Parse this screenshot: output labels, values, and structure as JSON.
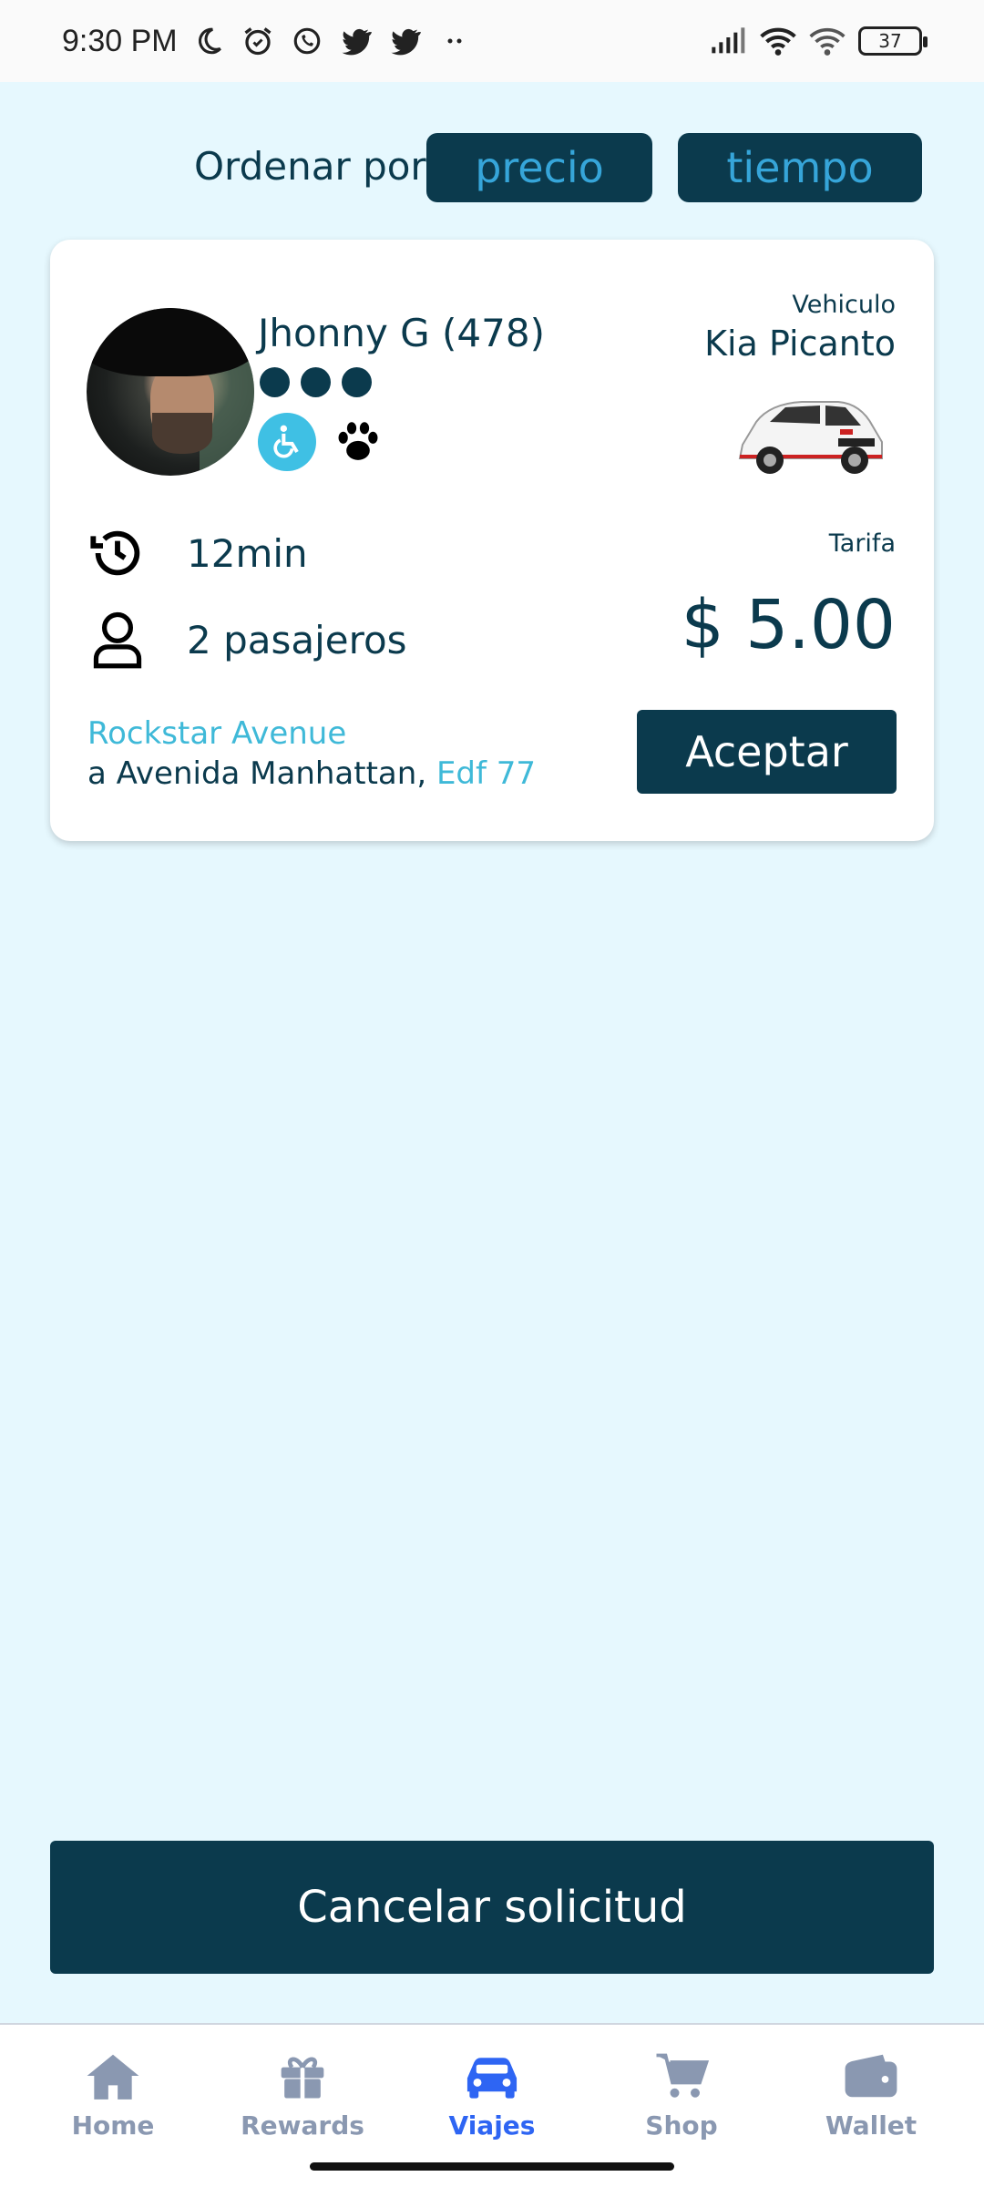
{
  "status_bar": {
    "time": "9:30 PM",
    "battery": "37"
  },
  "sort": {
    "label": "Ordenar por",
    "option_price": "precio",
    "option_time": "tiempo"
  },
  "trip_card": {
    "driver_name": "Jhonny G (478)",
    "vehicle_label": "Vehiculo",
    "vehicle_name": "Kia Picanto",
    "duration": "12min",
    "passengers": "2 pasajeros",
    "fare_label": "Tarifa",
    "fare_value": "$ 5.00",
    "route_from": "Rockstar Avenue",
    "route_to": "a Avenida Manhattan, ",
    "route_extra": "Edf 77",
    "accept_label": "Aceptar"
  },
  "cancel_label": "Cancelar solicitud",
  "bottom_nav": [
    {
      "label": "Home",
      "icon": "home-icon"
    },
    {
      "label": "Rewards",
      "icon": "gift-icon"
    },
    {
      "label": "Viajes",
      "icon": "car-icon",
      "active": true
    },
    {
      "label": "Shop",
      "icon": "cart-icon"
    },
    {
      "label": "Wallet",
      "icon": "wallet-icon"
    }
  ],
  "colors": {
    "primary": "#0b3a4d",
    "accent": "#3fb9d8",
    "background": "#e6f8fe",
    "nav_active": "#2e65f3",
    "nav_inactive": "#8a98b1"
  }
}
